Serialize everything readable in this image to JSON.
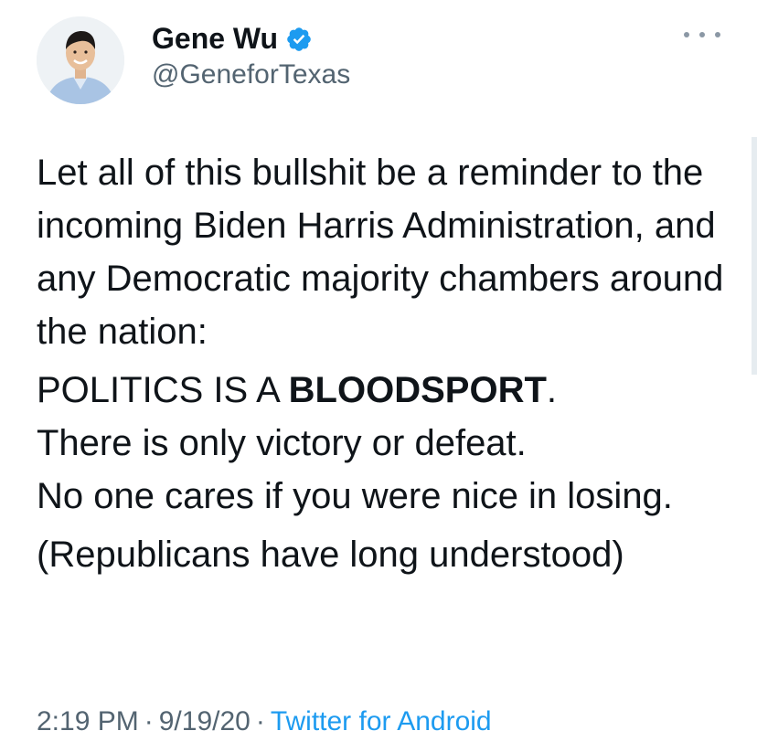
{
  "author": {
    "name": "Gene Wu",
    "handle": "@GeneforTexas",
    "verified": true
  },
  "tweet": {
    "paragraph1": "Let all of this bullshit be a reminder to the incoming Biden Harris Administration, and any Democratic majority chambers around the nation:",
    "p2_prefix": "POLITICS IS A ",
    "p2_bold": "BLOODSPORT",
    "p2_suffix": ".",
    "p2_line2": "There is only victory or defeat.",
    "p2_line3": "No one cares if you were nice in losing.",
    "paragraph3": "(Republicans have long understood)"
  },
  "meta": {
    "time": "2:19 PM",
    "date": "9/19/20",
    "separator": "·",
    "source": "Twitter for Android"
  },
  "colors": {
    "text": "#0f1419",
    "secondary": "#536471",
    "link": "#1d9bf0",
    "verified": "#1d9bf0"
  },
  "icons": {
    "verified": "verified-badge-icon",
    "more": "more-dots-icon"
  }
}
